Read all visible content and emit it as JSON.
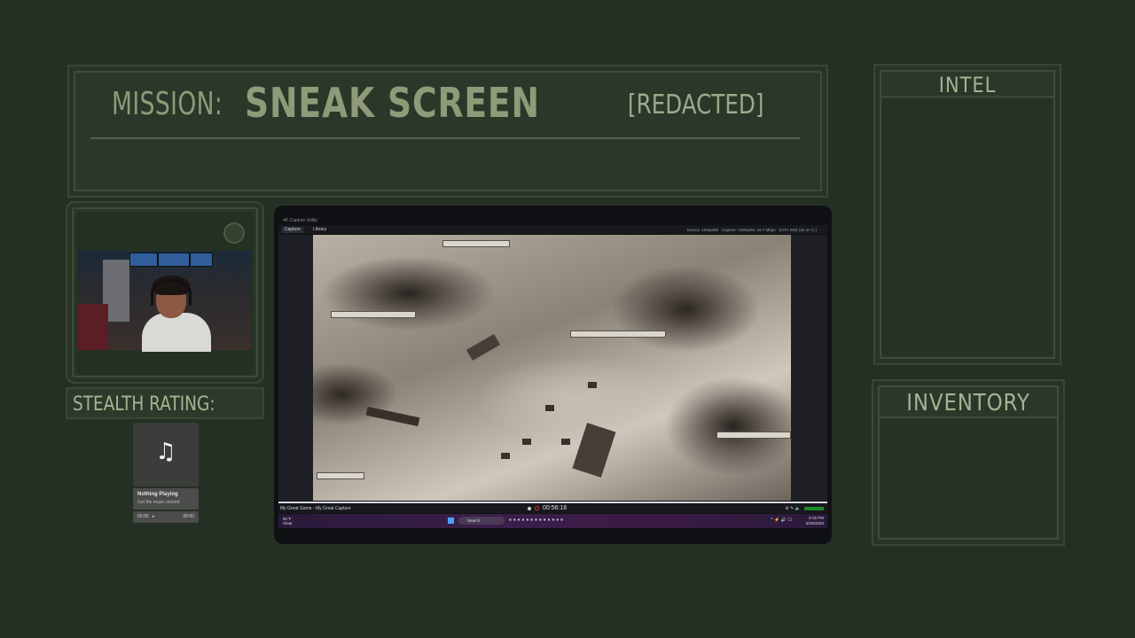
{
  "mission": {
    "label": "MISSION:",
    "name": "SNEAK SCREEN",
    "status": "[REDACTED]"
  },
  "stealth": {
    "label": "STEALTH RATING:"
  },
  "music": {
    "icon": "music-note-icon",
    "note_glyph": "♫",
    "title": "Nothing Playing",
    "subtitle": "Get the music started",
    "time_current": "00:00",
    "time_total": "00:00",
    "play_glyph": "▸"
  },
  "intel": {
    "title": "INTEL"
  },
  "inventory": {
    "title": "INVENTORY"
  },
  "capture_app": {
    "window_title": "4K Capture Utility",
    "tabs": [
      "Capture",
      "Library"
    ],
    "source": "Source: 1080p/60",
    "capture": "Capture: 1080p/60, 16.7 Mbps",
    "disk": "SATA SSD (tot on C:)",
    "capture_name": "My Great Game - My Great Capture",
    "timer": "00:56:16",
    "progress": 1.0
  },
  "taskbar": {
    "weather_temp": "81°F",
    "weather_desc": "Clear",
    "search_label": "Search",
    "clock_time": "8:15 PM",
    "clock_date": "8/29/2023"
  },
  "colors": {
    "background": "#243024",
    "panel": "#2a3829",
    "text": "#8e9a78"
  }
}
